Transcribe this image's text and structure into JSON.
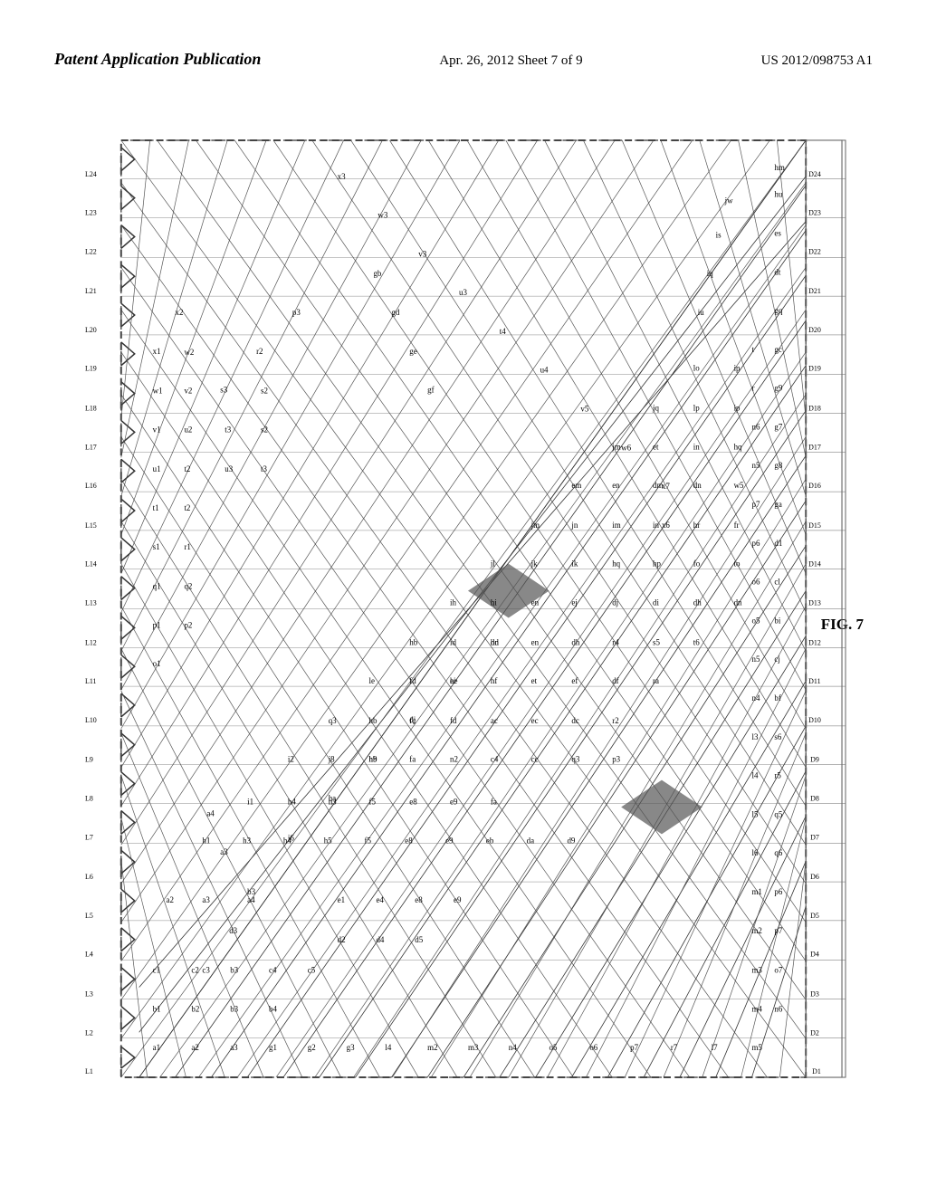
{
  "header": {
    "left_label": "Patent Application Publication",
    "center_label": "Apr. 26, 2012  Sheet 7 of 9",
    "right_label": "US 2012/098753 A1"
  },
  "figure": {
    "label": "FIG. 7"
  },
  "diagram": {
    "description": "Patent figure 7 showing a diagonal grid/matrix diagram with labeled lines L1-L24 on left, D1-D24 on right, and various alphanumeric labels at intersection points"
  }
}
